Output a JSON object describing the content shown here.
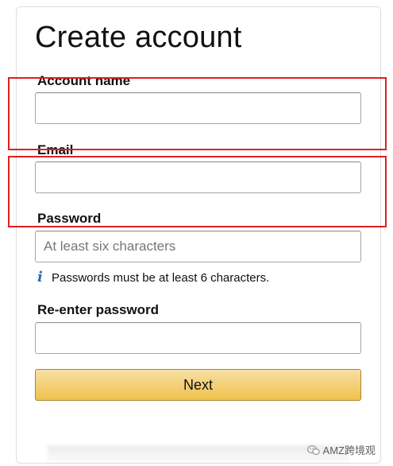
{
  "form": {
    "title": "Create account",
    "fields": {
      "account_name": {
        "label": "Account name",
        "value": "",
        "placeholder": ""
      },
      "email": {
        "label": "Email",
        "value": "",
        "placeholder": ""
      },
      "password": {
        "label": "Password",
        "value": "",
        "placeholder": "At least six characters"
      },
      "reenter_password": {
        "label": "Re-enter password",
        "value": "",
        "placeholder": ""
      }
    },
    "password_hint": "Passwords must be at least 6 characters.",
    "next_label": "Next"
  },
  "icons": {
    "info": "info-icon",
    "wechat": "wechat-icon"
  },
  "watermark": {
    "text": "AMZ跨境观"
  },
  "colors": {
    "highlight": "#e02020",
    "button_top": "#f7dfa5",
    "button_bottom": "#f0c14b",
    "info_icon": "#2a6fa8"
  }
}
